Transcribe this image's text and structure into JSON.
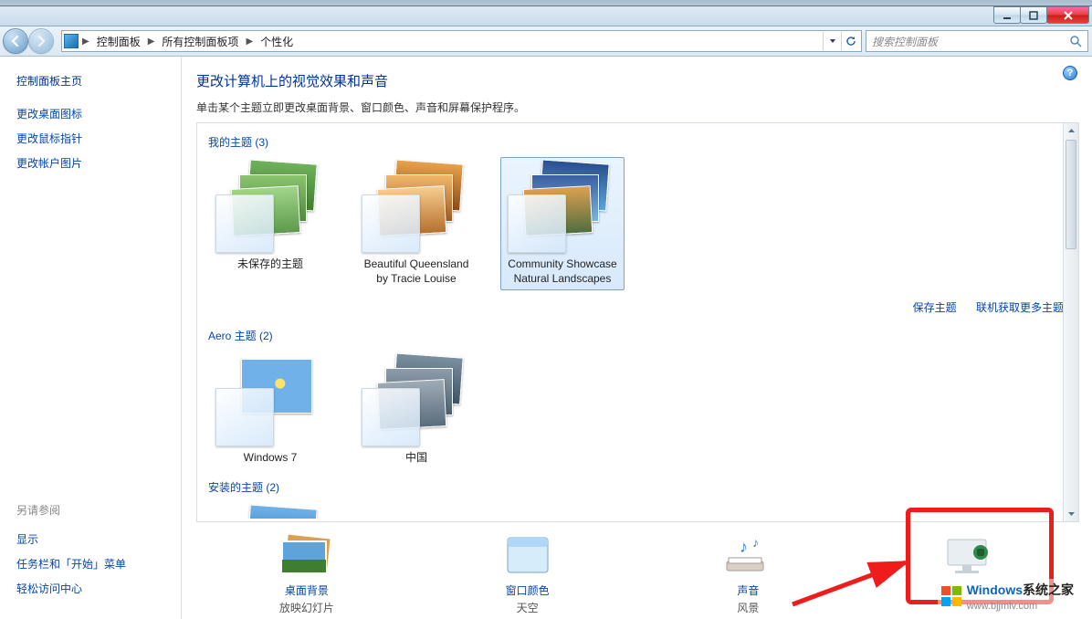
{
  "window": {
    "breadcrumb": [
      "控制面板",
      "所有控制面板项",
      "个性化"
    ],
    "search_placeholder": "搜索控制面板"
  },
  "sidebar": {
    "heading": "控制面板主页",
    "links": [
      "更改桌面图标",
      "更改鼠标指针",
      "更改帐户图片"
    ],
    "see_also_heading": "另请参阅",
    "see_also": [
      "显示",
      "任务栏和「开始」菜单",
      "轻松访问中心"
    ]
  },
  "main": {
    "title": "更改计算机上的视觉效果和声音",
    "subtitle": "单击某个主题立即更改桌面背景、窗口颜色、声音和屏幕保护程序。",
    "sections": {
      "my_themes": {
        "label": "我的主题 (3)",
        "items": [
          {
            "name": "未保存的主题"
          },
          {
            "name": "Beautiful Queensland by Tracie Louise"
          },
          {
            "name": "Community Showcase Natural Landscapes",
            "selected": true
          }
        ]
      },
      "aero": {
        "label": "Aero 主题 (2)",
        "items": [
          {
            "name": "Windows 7"
          },
          {
            "name": "中国"
          }
        ]
      },
      "installed": {
        "label": "安装的主题 (2)"
      }
    },
    "actions": {
      "save": "保存主题",
      "get_more": "联机获取更多主题"
    }
  },
  "bottom": {
    "items": [
      {
        "key": "desktop-background",
        "label1": "桌面背景",
        "label2": "放映幻灯片"
      },
      {
        "key": "window-color",
        "label1": "窗口颜色",
        "label2": "天空"
      },
      {
        "key": "sounds",
        "label1": "声音",
        "label2": "风景"
      },
      {
        "key": "screensaver",
        "label1": "",
        "label2": ""
      }
    ]
  },
  "watermark": {
    "brand_a": "Windows",
    "brand_b": "系统之家",
    "url": "www.bjjmlv.com"
  }
}
